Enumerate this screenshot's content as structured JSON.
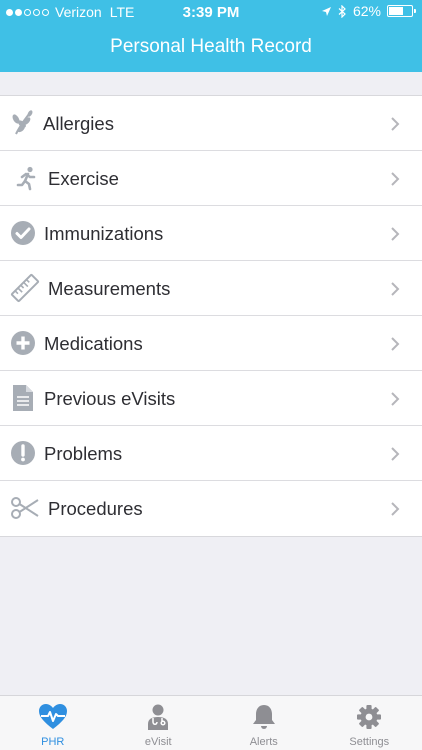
{
  "status_bar": {
    "carrier": "Verizon",
    "network": "LTE",
    "time": "3:39 PM",
    "battery_text": "62%",
    "battery_level": 0.62,
    "signal_bars_filled": 2,
    "signal_bars_total": 5
  },
  "header": {
    "title": "Personal Health Record"
  },
  "menu": {
    "items": [
      {
        "label": "Allergies",
        "icon": "leaf-icon"
      },
      {
        "label": "Exercise",
        "icon": "running-person-icon"
      },
      {
        "label": "Immunizations",
        "icon": "checkmark-circle-icon"
      },
      {
        "label": "Measurements",
        "icon": "ruler-icon"
      },
      {
        "label": "Medications",
        "icon": "plus-circle-icon"
      },
      {
        "label": "Previous eVisits",
        "icon": "document-icon"
      },
      {
        "label": "Problems",
        "icon": "exclamation-circle-icon"
      },
      {
        "label": "Procedures",
        "icon": "scissors-icon"
      }
    ]
  },
  "tabbar": {
    "active": "PHR",
    "tabs": [
      {
        "label": "PHR",
        "icon": "heart-pulse-icon"
      },
      {
        "label": "eVisit",
        "icon": "doctor-icon"
      },
      {
        "label": "Alerts",
        "icon": "bell-icon"
      },
      {
        "label": "Settings",
        "icon": "gear-icon"
      }
    ]
  },
  "colors": {
    "header_bg": "#3fc0e6",
    "icon_gray": "#a7adb5",
    "chevron_gray": "#b6b6bb",
    "active_tab": "#2f8fe0",
    "inactive_tab": "#8e8e93"
  }
}
